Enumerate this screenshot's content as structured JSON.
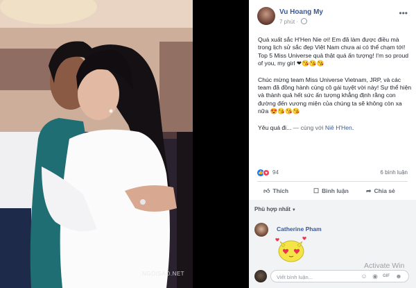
{
  "post": {
    "author": "Vu Hoang My",
    "time": "7 phút",
    "paragraph1": "Quá xuất sắc H'Hen Nie ơi! Em đã làm được điều mà trong lịch sử sắc đẹp Việt Nam chưa ai có thể chạm tới! Top 5 Miss Universe quả thật quá ấn tượng! I'm so proud of you, my girl ❤😘😘😘",
    "paragraph2": "Chúc mừng team Miss Universe Vietnam, JRP, và các team đã đồng hành cùng cô gái tuyệt vời này! Sự thể hiện và thành quả hết sức ấn tượng khẳng định rằng con đường đến vương miện của chúng ta sẽ không còn xa nữa 😍😘😘😘",
    "p3_start": "Yêu quá đi...",
    "p3_with": "— cùng với",
    "p3_tag": "Niê H'Hen",
    "p3_end": "."
  },
  "stats": {
    "reaction_count": "94",
    "comment_count": "6 bình luận"
  },
  "actions": {
    "like": "Thích",
    "comment": "Bình luận",
    "share": "Chia sẻ"
  },
  "comments": {
    "sort_label": "Phù hợp nhất",
    "first_commenter": "Catherine Pham"
  },
  "composer": {
    "placeholder": "Viết bình luận..."
  },
  "photo": {
    "watermark": "NGOISAO.NET"
  },
  "overlay": {
    "activate": "Activate Win"
  },
  "colors": {
    "link": "#385898",
    "facebook_blue": "#1877f2",
    "love_red": "#f33e58"
  },
  "icons": [
    "globe-icon",
    "more-icon",
    "like-icon",
    "love-icon",
    "comment-icon",
    "share-icon",
    "emoji-icon",
    "camera-icon",
    "gif-icon",
    "sticker-icon"
  ]
}
